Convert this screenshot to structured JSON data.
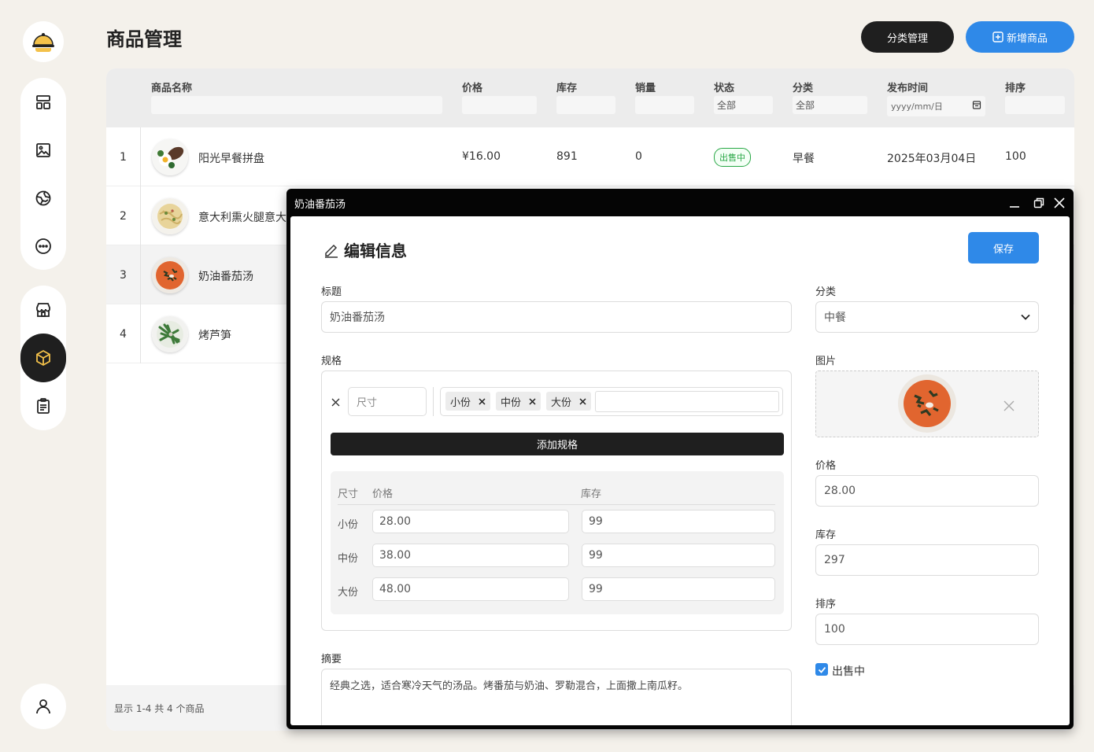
{
  "page": {
    "title": "商品管理",
    "category_btn": "分类管理",
    "add_btn": "新增商品"
  },
  "table": {
    "headers": [
      "商品名称",
      "价格",
      "库存",
      "销量",
      "状态",
      "分类",
      "发布时间",
      "排序"
    ],
    "filters": {
      "status": "全部",
      "category": "全部",
      "date_placeholder": "yyyy/mm/日"
    },
    "rows": [
      {
        "idx": "1",
        "name": "阳光早餐拼盘",
        "price": "¥16.00",
        "stock": "891",
        "sales": "0",
        "status": "出售中",
        "category": "早餐",
        "date": "2025年03月04日",
        "sort": "100"
      },
      {
        "idx": "2",
        "name": "意大利熏火腿意大"
      },
      {
        "idx": "3",
        "name": "奶油番茄汤"
      },
      {
        "idx": "4",
        "name": "烤芦笋"
      }
    ],
    "footer": "显示 1-4 共 4 个商品"
  },
  "window": {
    "title": "奶油番茄汤",
    "heading": "编辑信息",
    "save": "保存",
    "title_label": "标题",
    "title_value": "奶油番茄汤",
    "category_label": "分类",
    "category_value": "中餐",
    "image_label": "图片",
    "spec_label": "规格",
    "spec_name_placeholder": "尺寸",
    "spec_tags": [
      "小份",
      "中份",
      "大份"
    ],
    "add_spec": "添加规格",
    "spec_table": {
      "headers": [
        "尺寸",
        "价格",
        "库存"
      ],
      "rows": [
        {
          "size": "小份",
          "price": "28.00",
          "stock": "99"
        },
        {
          "size": "中份",
          "price": "38.00",
          "stock": "99"
        },
        {
          "size": "大份",
          "price": "48.00",
          "stock": "99"
        }
      ]
    },
    "price_label": "价格",
    "price_value": "28.00",
    "stock_label": "库存",
    "stock_value": "297",
    "sort_label": "排序",
    "sort_value": "100",
    "on_sale_label": "出售中",
    "summary_label": "摘要",
    "summary_value": "经典之选，适合寒冷天气的汤品。烤番茄与奶油、罗勒混合，上面撒上南瓜籽。"
  },
  "colors": {
    "accent": "#2f89e8",
    "dark": "#1f1f1f",
    "success": "#28a745",
    "background": "#f4f1eb"
  }
}
